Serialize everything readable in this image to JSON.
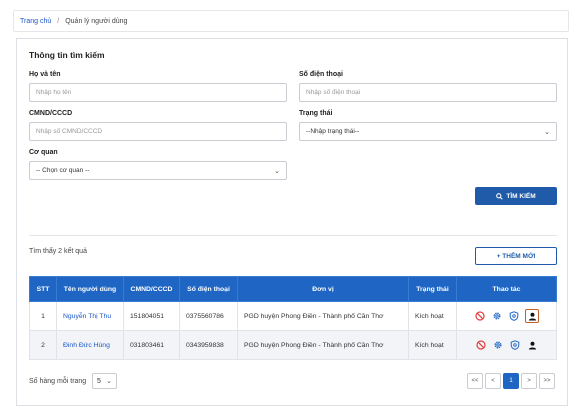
{
  "breadcrumb": {
    "home": "Trang chủ",
    "separator": "/",
    "current": "Quản lý người dùng"
  },
  "search": {
    "title": "Thông tin tìm kiếm",
    "fullname": {
      "label": "Họ và tên",
      "placeholder": "Nhập họ tên"
    },
    "phone": {
      "label": "Số điện thoại",
      "placeholder": "Nhập số điện thoại"
    },
    "idcard": {
      "label": "CMND/CCCD",
      "placeholder": "Nhập số CMND/CCCD"
    },
    "status": {
      "label": "Trạng thái",
      "value": "--Nhập trạng thái--"
    },
    "agency": {
      "label": "Cơ quan",
      "value": "-- Chọn cơ quan --"
    },
    "button": "TÌM KIẾM"
  },
  "results": {
    "count_text": "Tìm thấy 2 kết quả",
    "add_button": "+ THÊM MỚI",
    "columns": [
      "STT",
      "Tên người dùng",
      "CMND/CCCD",
      "Số điện thoại",
      "Đơn vị",
      "Trạng thái",
      "Thao tác"
    ],
    "rows": [
      {
        "stt": "1",
        "name": "Nguyễn Thị Thu",
        "idcard": "151804051",
        "phone": "0375560786",
        "unit": "PGD huyện Phong Điền - Thành phố Cần Thơ",
        "status": "Kích hoạt"
      },
      {
        "stt": "2",
        "name": "Đinh Đức Hùng",
        "idcard": "031803461",
        "phone": "0343959838",
        "unit": "PGD huyện Phong Điền - Thành phố Cần Thơ",
        "status": "Kích hoạt"
      }
    ],
    "action_icons": [
      "ban-icon",
      "gear-icon",
      "shield-icon",
      "user-icon"
    ]
  },
  "pagination": {
    "page_size_label": "Số hàng mỗi trang",
    "page_size": "5",
    "first": "<<",
    "prev": "<",
    "current": "1",
    "next": ">",
    "last": ">>"
  },
  "colors": {
    "primary": "#1f66c4",
    "danger": "#e04040",
    "highlight": "#c2622a"
  }
}
